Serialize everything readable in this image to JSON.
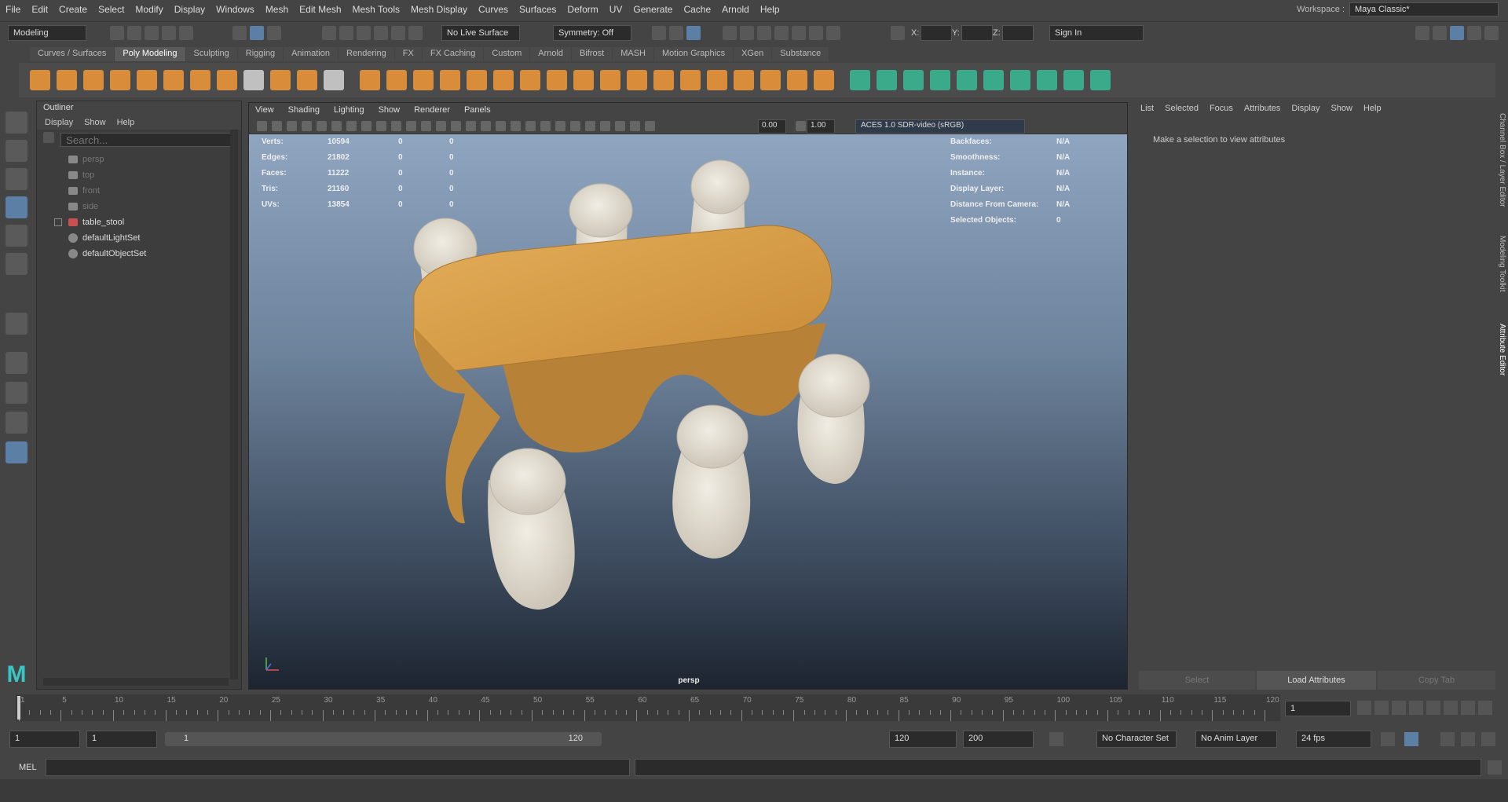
{
  "menus": [
    "File",
    "Edit",
    "Create",
    "Select",
    "Modify",
    "Display",
    "Windows",
    "Mesh",
    "Edit Mesh",
    "Mesh Tools",
    "Mesh Display",
    "Curves",
    "Surfaces",
    "Deform",
    "UV",
    "Generate",
    "Cache",
    "Arnold",
    "Help"
  ],
  "workspace": {
    "label": "Workspace :",
    "value": "Maya Classic*"
  },
  "status": {
    "mode": "Modeling",
    "live_surface": "No Live Surface",
    "symmetry": "Symmetry: Off",
    "x_label": "X:",
    "y_label": "Y:",
    "z_label": "Z:",
    "sign_in": "Sign In"
  },
  "shelf_tabs": [
    "Curves / Surfaces",
    "Poly Modeling",
    "Sculpting",
    "Rigging",
    "Animation",
    "Rendering",
    "FX",
    "FX Caching",
    "Custom",
    "Arnold",
    "Bifrost",
    "MASH",
    "Motion Graphics",
    "XGen",
    "Substance"
  ],
  "shelf_active": "Poly Modeling",
  "outliner": {
    "title": "Outliner",
    "menu": [
      "Display",
      "Show",
      "Help"
    ],
    "search_placeholder": "Search...",
    "items": [
      {
        "label": "persp",
        "icon": "camera-icon",
        "dim": true
      },
      {
        "label": "top",
        "icon": "camera-icon",
        "dim": true
      },
      {
        "label": "front",
        "icon": "camera-icon",
        "dim": true
      },
      {
        "label": "side",
        "icon": "camera-icon",
        "dim": true
      },
      {
        "label": "table_stool",
        "icon": "mesh-group-icon",
        "dim": false
      },
      {
        "label": "defaultLightSet",
        "icon": "set-icon",
        "dim": false
      },
      {
        "label": "defaultObjectSet",
        "icon": "set-icon",
        "dim": false
      }
    ]
  },
  "viewport": {
    "menu": [
      "View",
      "Shading",
      "Lighting",
      "Show",
      "Renderer",
      "Panels"
    ],
    "exposure": "0.00",
    "gamma": "1.00",
    "colorspace": "ACES 1.0 SDR-video (sRGB)",
    "camera_label": "persp",
    "hud_left": [
      {
        "name": "Verts:",
        "a": "10594",
        "b": "0",
        "c": "0"
      },
      {
        "name": "Edges:",
        "a": "21802",
        "b": "0",
        "c": "0"
      },
      {
        "name": "Faces:",
        "a": "11222",
        "b": "0",
        "c": "0"
      },
      {
        "name": "Tris:",
        "a": "21160",
        "b": "0",
        "c": "0"
      },
      {
        "name": "UVs:",
        "a": "13854",
        "b": "0",
        "c": "0"
      }
    ],
    "hud_right": [
      {
        "name": "Backfaces:",
        "v": "N/A"
      },
      {
        "name": "Smoothness:",
        "v": "N/A"
      },
      {
        "name": "Instance:",
        "v": "N/A"
      },
      {
        "name": "Display Layer:",
        "v": "N/A"
      },
      {
        "name": "Distance From Camera:",
        "v": "N/A"
      },
      {
        "name": "Selected Objects:",
        "v": "0"
      }
    ]
  },
  "attribute_editor": {
    "menu": [
      "List",
      "Selected",
      "Focus",
      "Attributes",
      "Display",
      "Show",
      "Help"
    ],
    "message": "Make a selection to view attributes",
    "buttons": [
      "Select",
      "Load Attributes",
      "Copy Tab"
    ],
    "side_tabs": [
      "Channel Box / Layer Editor",
      "Modeling Toolkit",
      "Attribute Editor"
    ]
  },
  "timeline": {
    "ticks": [
      "1",
      "5",
      "10",
      "15",
      "20",
      "25",
      "30",
      "35",
      "40",
      "45",
      "50",
      "55",
      "60",
      "65",
      "70",
      "75",
      "80",
      "85",
      "90",
      "95",
      "100",
      "105",
      "110",
      "115",
      "120"
    ],
    "current_frame": "1"
  },
  "range": {
    "start": "1",
    "start2": "1",
    "slider_start": "1",
    "slider_end": "120",
    "end": "120",
    "end2": "200",
    "character_set": "No Character Set",
    "anim_layer": "No Anim Layer",
    "fps": "24 fps"
  },
  "mel": {
    "label": "MEL"
  }
}
